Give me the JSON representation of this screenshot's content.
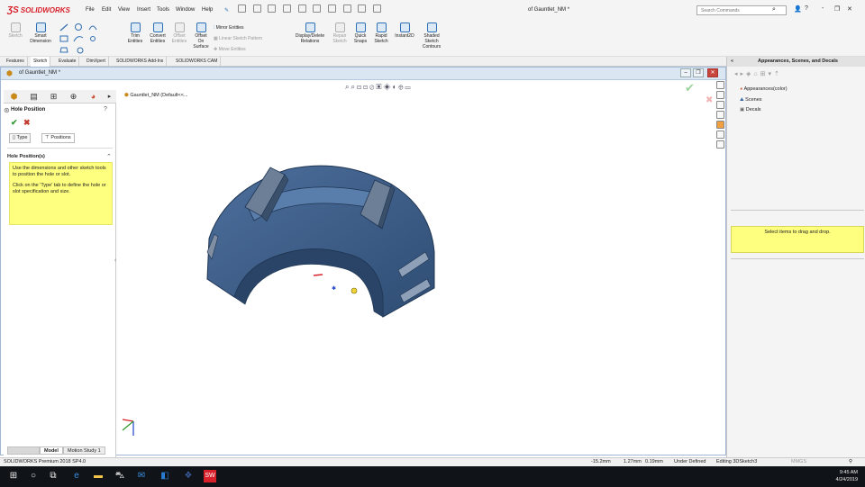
{
  "app": {
    "brand": "SOLIDWORKS",
    "menu": [
      "File",
      "Edit",
      "View",
      "Insert",
      "Tools",
      "Window",
      "Help"
    ],
    "document_title": "of Gauntlet_NM *",
    "search_placeholder": "Search Commands",
    "window_buttons": [
      "?",
      "-",
      "❐",
      "✕"
    ]
  },
  "commands": {
    "sketch": "Sketch",
    "smart_dimension": [
      "Smart",
      "Dimension"
    ],
    "trim": [
      "Trim",
      "Entities"
    ],
    "convert": [
      "Convert",
      "Entities"
    ],
    "offset_entities": [
      "Offset",
      "Entities"
    ],
    "offset_surface": [
      "Offset",
      "On",
      "Surface"
    ],
    "mirror": "Mirror Entities",
    "linear_pattern": "Linear Sketch Pattern",
    "move": "Move Entities",
    "display_delete": [
      "Display/Delete",
      "Relations"
    ],
    "repair": [
      "Repair",
      "Sketch"
    ],
    "quick_snaps": [
      "Quick",
      "Snaps"
    ],
    "rapid_sketch": [
      "Rapid",
      "Sketch"
    ],
    "instant2d": "Instant2D",
    "shaded_contours": [
      "Shaded",
      "Sketch",
      "Contours"
    ]
  },
  "cm_tabs": [
    "Features",
    "Sketch",
    "Evaluate",
    "DimXpert",
    "SOLIDWORKS Add-Ins",
    "SOLIDWORKS CAM"
  ],
  "cm_active_tab": "Sketch",
  "doc_window": {
    "title": "of Gauntlet_NM *",
    "tree_node": "Gauntlet_NM (Default<<..."
  },
  "property_manager": {
    "title": "Hole Position",
    "subtabs": [
      "Type",
      "Positions"
    ],
    "section_title": "Hole Position(s)",
    "message_1": "Use the dimensions and other sketch tools to position the hole or slot.",
    "message_2": "Click on the 'Type' tab to define the hole or slot specification and size."
  },
  "model_tabs": [
    "Model",
    "Motion Study 1"
  ],
  "task_pane": {
    "title": "Appearances, Scenes, and Decals",
    "items": [
      "Appearances(color)",
      "Scenes",
      "Decals"
    ],
    "hint": "Select items to drag and drop."
  },
  "status": {
    "product": "SOLIDWORKS Premium 2018 SP4.0",
    "x": "-15.2mm",
    "y": "1.27mm",
    "z": "0.19mm",
    "state": "Under Defined",
    "editing": "Editing 3DSketch3",
    "units": "MMGS"
  },
  "taskbar": {
    "time": "9:45 AM",
    "date": "4/24/2019"
  },
  "colors": {
    "part": "#3d5f8a",
    "part_dark": "#2e4a6e",
    "note_yellow": "#ffff7f",
    "accent_red": "#d8202a"
  }
}
